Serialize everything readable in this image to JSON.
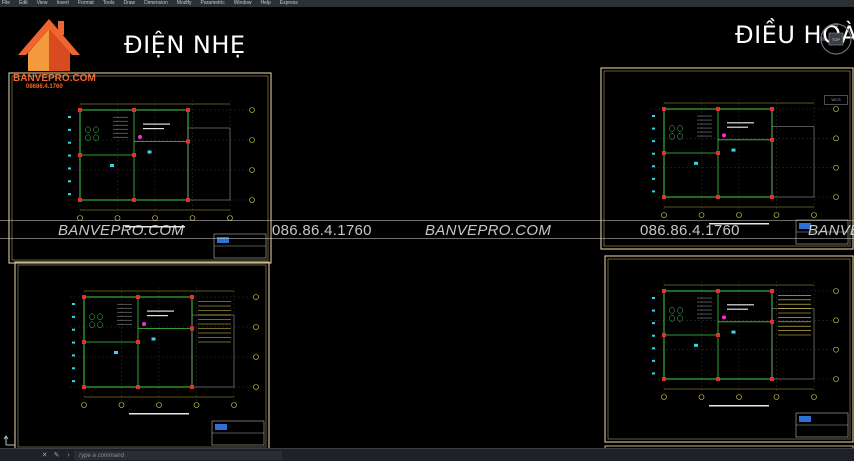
{
  "menubar": {
    "items": [
      "File",
      "Edit",
      "View",
      "Insert",
      "Format",
      "Tools",
      "Draw",
      "Dimension",
      "Modify",
      "Parametric",
      "Window",
      "Help",
      "Express"
    ]
  },
  "logo": {
    "brand": "BANVEPRO.COM",
    "phone": "08686.4.1760"
  },
  "headings": {
    "left": "ĐIỆN NHẸ",
    "right": "ĐIỀU HOÀ"
  },
  "watermark": {
    "items": [
      "BANVEPRO.COM",
      "086.86.4.1760",
      "BANVEPRO.COM",
      "086.86.4.1760",
      "BANVEPRO"
    ]
  },
  "viewcube": {
    "top_label": "TOP",
    "west_label": "W",
    "north_label": "N"
  },
  "right_badge": "WCS",
  "command": {
    "placeholder": "Type a command"
  },
  "colors": {
    "background": "#000000",
    "logo_orange": "#f0652f",
    "sheet_border": "#c9b98a",
    "wall_green": "#3fcf4a",
    "dim_yellow": "#e3d34f",
    "mark_red": "#e0322f",
    "mark_cyan": "#35d6e8"
  }
}
